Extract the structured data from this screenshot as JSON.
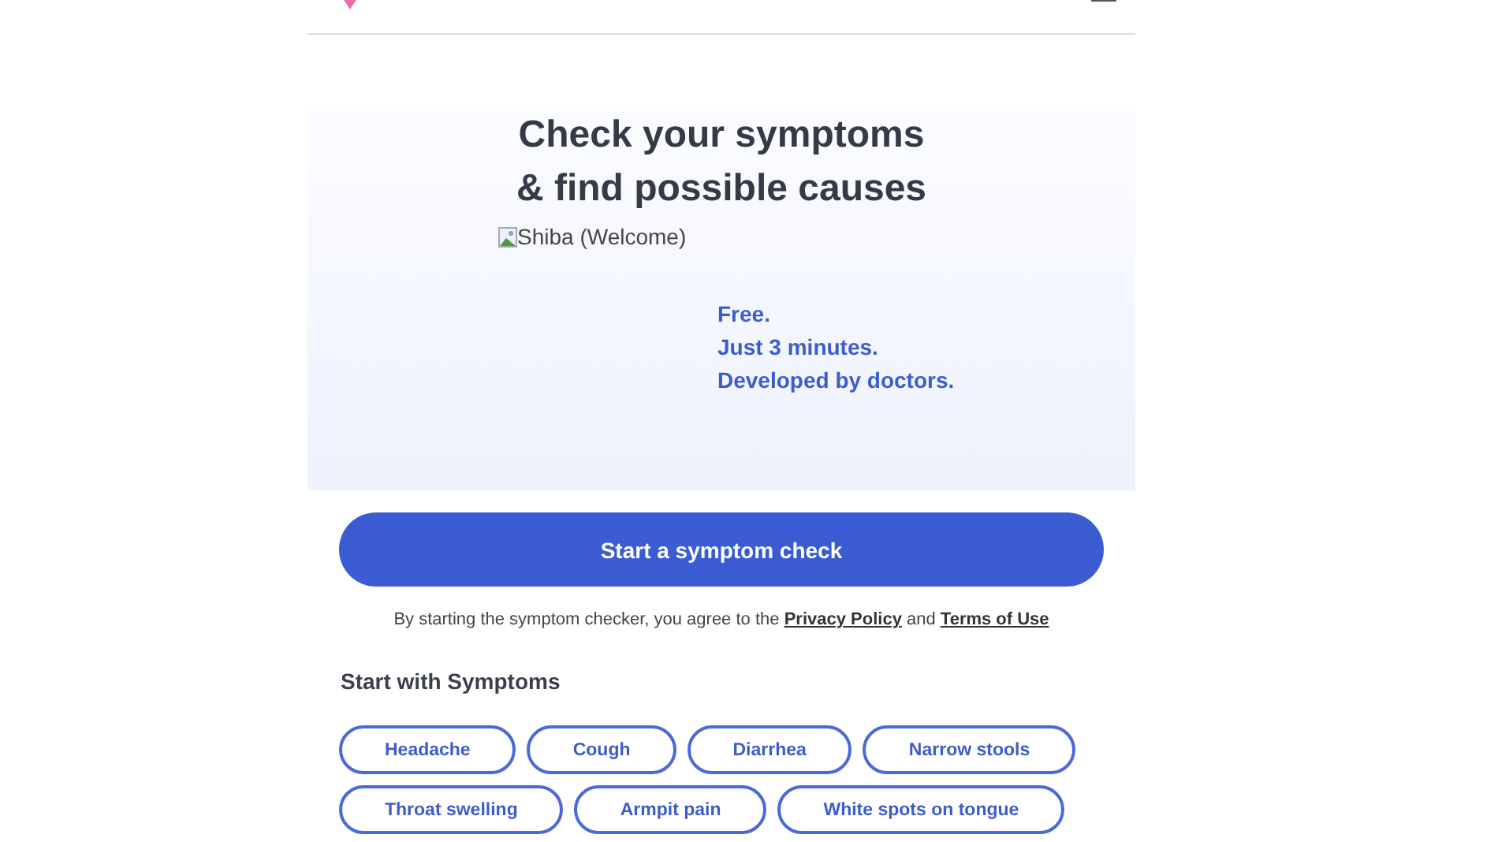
{
  "hero": {
    "title_lines": [
      "Check your symptoms",
      "& find possible causes"
    ],
    "image_alt": "Shiba (Welcome)",
    "taglines": [
      "Free.",
      "Just 3 minutes.",
      "Developed by doctors."
    ]
  },
  "start_button": {
    "label": "Start a symptom check"
  },
  "consent": {
    "text": "By starting the symptom checker, you agree to the",
    "privacy_link": "Privacy Policy",
    "joiner": "and",
    "terms_link": "Terms of Use"
  },
  "symptoms": {
    "heading": "Start with Symptoms",
    "chips": [
      "Headache",
      "Cough",
      "Diarrhea",
      "Narrow stools",
      "Throat swelling",
      "Armpit pain",
      "White spots on tongue"
    ]
  }
}
